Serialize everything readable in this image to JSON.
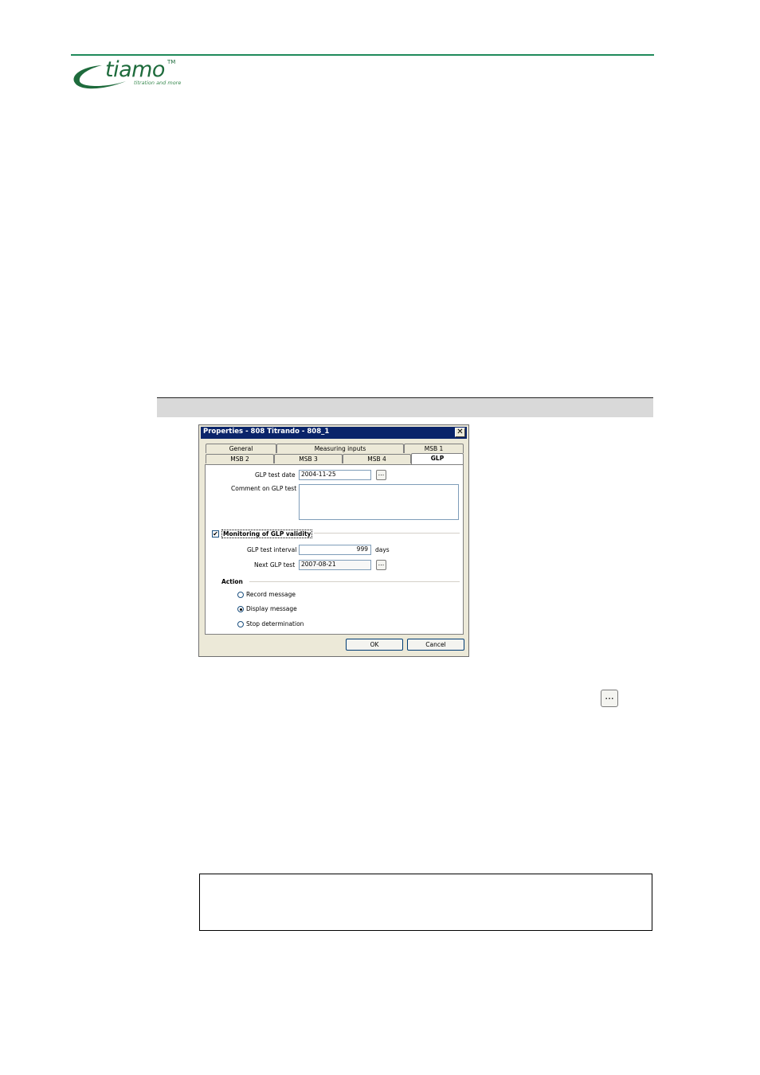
{
  "logo": {
    "brand": "tiamo",
    "trademark": "TM",
    "tagline": "titration and more"
  },
  "dialog": {
    "title": "Properties - 808 Titrando - 808_1",
    "close_glyph": "✕",
    "tabs_row1": [
      "General",
      "Measuring inputs",
      "MSB 1"
    ],
    "tabs_row2": [
      "MSB 2",
      "MSB 3",
      "MSB 4",
      "GLP"
    ],
    "active_tab": "GLP",
    "glp_test_date_label": "GLP test date",
    "glp_test_date_value": "2004-11-25",
    "comment_label": "Comment on GLP test",
    "comment_value": "",
    "monitoring_label": "Monitoring of GLP validity",
    "monitoring_checked": true,
    "interval_label": "GLP test interval",
    "interval_value": "999",
    "interval_unit": "days",
    "next_label": "Next GLP test",
    "next_value": "2007-08-21",
    "action_label": "Action",
    "actions": [
      "Record message",
      "Display message",
      "Stop determination"
    ],
    "selected_action": "Display message",
    "ellipsis": "...",
    "ok_label": "OK",
    "cancel_label": "Cancel"
  },
  "standalone_button": {
    "label": "..."
  },
  "colors": {
    "brand_green": "#1e6b3c",
    "rule_green": "#1f8a5a",
    "titlebar": "#0a246a",
    "dialog_bg": "#ece9d8"
  }
}
